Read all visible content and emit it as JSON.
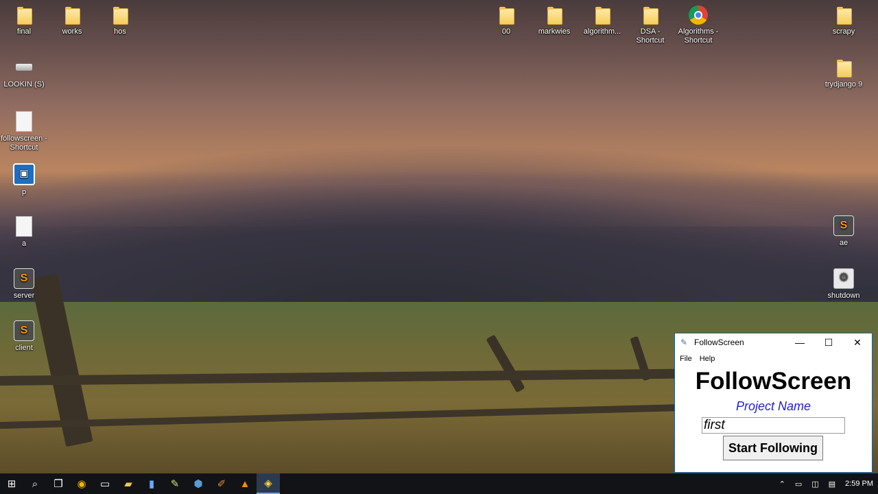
{
  "desktop": {
    "icons_left": [
      {
        "label": "final",
        "type": "folder"
      },
      {
        "label": "works",
        "type": "folder"
      },
      {
        "label": "hos",
        "type": "folder"
      },
      {
        "label": "LOOKIN (S)",
        "type": "drive"
      },
      {
        "label": "followscreen - Shortcut",
        "type": "shortcut"
      },
      {
        "label": "p",
        "type": "app"
      },
      {
        "label": "a",
        "type": "app"
      },
      {
        "label": "server",
        "type": "sublime"
      },
      {
        "label": "client",
        "type": "sublime"
      }
    ],
    "icons_top_middle": [
      {
        "label": "00",
        "type": "folder"
      },
      {
        "label": "markwies",
        "type": "folder"
      },
      {
        "label": "algorithm...",
        "type": "folder"
      },
      {
        "label": "DSA - Shortcut",
        "type": "folder-shortcut"
      },
      {
        "label": "Algorithms - Shortcut",
        "type": "chrome"
      }
    ],
    "icons_right": [
      {
        "label": "scrapy",
        "type": "folder"
      },
      {
        "label": "trydjango 9",
        "type": "folder"
      },
      {
        "label": "ae",
        "type": "sublime"
      },
      {
        "label": "shutdown",
        "type": "gear"
      }
    ]
  },
  "window": {
    "title": "FollowScreen",
    "icon": "feather-icon",
    "menu": [
      "File",
      "Help"
    ],
    "heading": "FollowScreen",
    "project_label": "Project Name",
    "project_value": "first",
    "start_button": "Start Following"
  },
  "taskbar": {
    "items": [
      "start-icon",
      "search-icon",
      "task-view-icon",
      "chrome-icon",
      "terminal-icon",
      "file-explorer-icon",
      "app-icon",
      "notepad-icon",
      "virtualbox-icon",
      "brush-icon",
      "vlc-icon",
      "python-icon"
    ],
    "clock": "2:59 PM"
  }
}
